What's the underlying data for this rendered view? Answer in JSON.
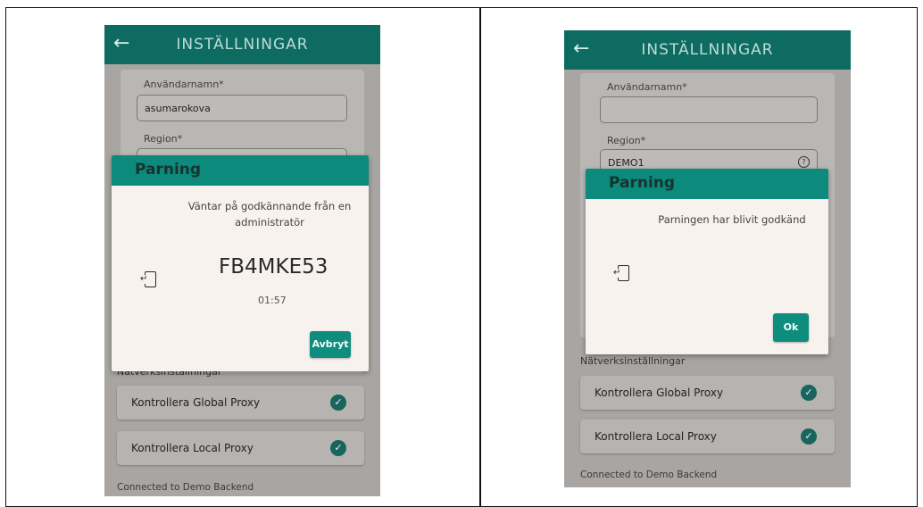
{
  "left": {
    "appbar": {
      "title": "INSTÄLLNINGAR"
    },
    "username_label": "Användarnamn*",
    "username_value": "asumarokova",
    "region_label": "Region*",
    "section_label": "Nätverksinställningar",
    "proxies": [
      "Kontrollera Global Proxy",
      "Kontrollera Local Proxy"
    ],
    "footer": "Connected to Demo Backend",
    "dialog": {
      "title": "Parning",
      "message_line1": "Väntar på godkännande från en",
      "message_line2": "administratör",
      "code": "FB4MKE53",
      "timer": "01:57",
      "button": "Avbryt"
    }
  },
  "right": {
    "appbar": {
      "title": "INSTÄLLNINGAR"
    },
    "username_label": "Användarnamn*",
    "username_value": "",
    "region_label": "Region*",
    "region_value": "DEMO1",
    "section_label": "Nätverksinställningar",
    "proxies": [
      "Kontrollera Global Proxy",
      "Kontrollera Local Proxy"
    ],
    "footer": "Connected to Demo Backend",
    "dialog": {
      "title": "Parning",
      "message": "Parningen har blivit godkänd",
      "button": "Ok"
    }
  },
  "colors": {
    "appbar": "#0d6b62",
    "dialog_header": "#0c8a7c",
    "button": "#0e8d7e",
    "check": "#17655d"
  },
  "icons": {
    "back": "arrow-left-icon",
    "help": "question-circle-icon",
    "device": "device-pairing-icon",
    "check": "check-circle-icon"
  }
}
